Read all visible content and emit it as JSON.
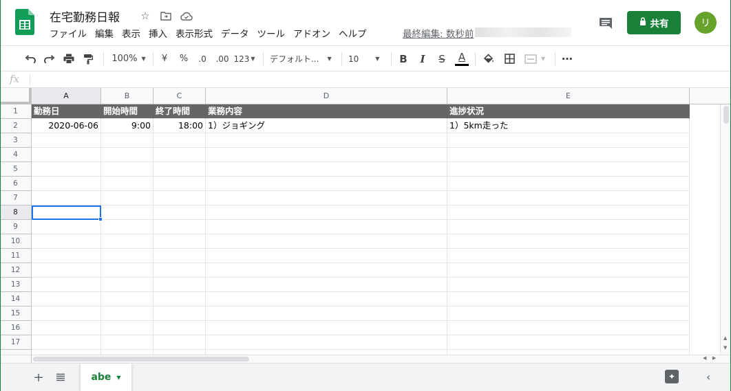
{
  "app": {
    "doc_title": "在宅勤務日報",
    "brand_color": "#188038",
    "accent_color": "#1a73e8",
    "icons": [
      "sheets-logo-icon",
      "star-icon",
      "move-to-folder-icon",
      "cloud-status-icon",
      "comment-icon",
      "lock-icon"
    ]
  },
  "menubar": {
    "items": [
      "ファイル",
      "編集",
      "表示",
      "挿入",
      "表示形式",
      "データ",
      "ツール",
      "アドオン",
      "ヘルプ"
    ],
    "last_edit": "最終編集: 数秒前"
  },
  "header": {
    "share_label": "共有",
    "avatar_letter": "リ"
  },
  "toolbar": {
    "zoom": "100%",
    "currency": "¥",
    "percent": "%",
    "decrease_decimal": ".0",
    "increase_decimal": ".00",
    "number_format": "123",
    "font_family": "デフォルト...",
    "font_size": "10",
    "bold": "B",
    "italic": "I",
    "strikethrough": "S",
    "text_color_letter": "A",
    "more": "⋮"
  },
  "formula_bar": {
    "fx_label": "fx",
    "value": ""
  },
  "grid": {
    "columns": [
      "A",
      "B",
      "C",
      "D",
      "E"
    ],
    "selected_column": "A",
    "selected_row": 8,
    "row_numbers": [
      "1",
      "2",
      "3",
      "4",
      "5",
      "6",
      "7",
      "8",
      "9",
      "10",
      "11",
      "12",
      "13",
      "14",
      "15",
      "16",
      "17"
    ],
    "header_row": [
      "勤務日",
      "開始時間",
      "終了時間",
      "業務内容",
      "進捗状況"
    ],
    "data_rows": [
      [
        "2020-06-06",
        "9:00",
        "18:00",
        "1）ジョギング",
        "1）5km走った"
      ]
    ],
    "header_fill": "#666666"
  },
  "sheets": {
    "add_label": "+",
    "active_tab": "abe"
  }
}
